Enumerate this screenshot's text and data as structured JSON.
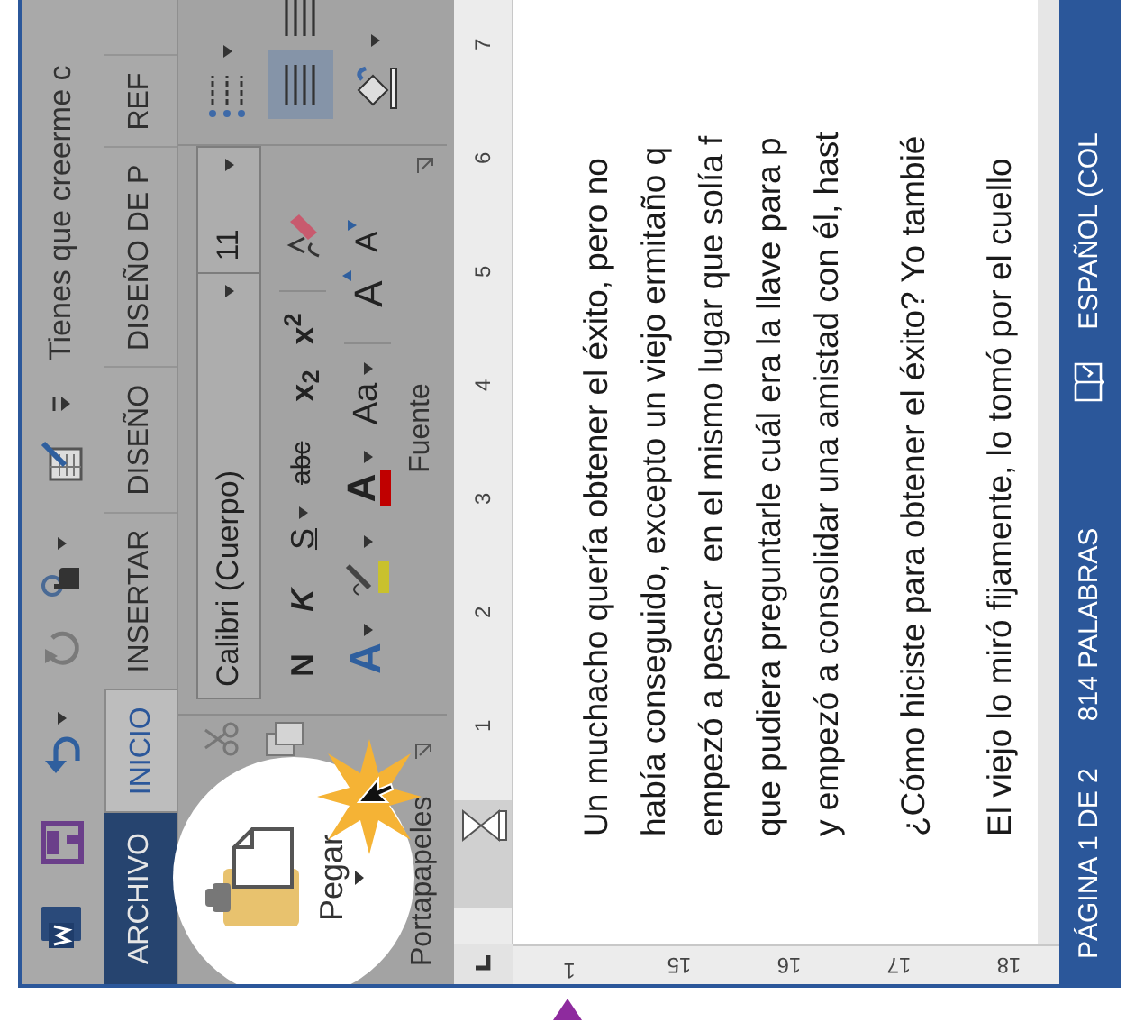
{
  "title_bar": {
    "title": "Tienes que creerme c"
  },
  "tabs": [
    {
      "label": "ARCHIVO",
      "kind": "file",
      "selected": false
    },
    {
      "label": "INICIO",
      "kind": "tab",
      "selected": true
    },
    {
      "label": "INSERTAR",
      "kind": "tab",
      "selected": false
    },
    {
      "label": "DISEÑO",
      "kind": "tab",
      "selected": false
    },
    {
      "label": "DISEÑO DE P",
      "kind": "tab",
      "selected": false
    },
    {
      "label": "REF",
      "kind": "tab",
      "selected": false
    }
  ],
  "ribbon": {
    "clipboard": {
      "paste_label": "Pegar",
      "group_label": "Portapapeles"
    },
    "font": {
      "font_name": "Calibri (Cuerpo)",
      "font_size": "11",
      "bold": "N",
      "italic": "K",
      "underline": "S",
      "strikethrough": "abc",
      "subscript": "x$_{2}$",
      "superscript": "x$^{2}$",
      "text_effects": "A",
      "font_color": "A",
      "change_case": "Aa",
      "grow_font": "A",
      "shrink_font": "A",
      "group_label": "Fuente"
    },
    "paragraph": {
      "align_button_selected": true
    }
  },
  "rulers": {
    "horizontal": [
      "1",
      "2",
      "3",
      "4",
      "5",
      "6",
      "7"
    ],
    "vertical": [
      "1",
      "15",
      "16",
      "17",
      "18"
    ]
  },
  "document": {
    "paragraphs": [
      {
        "lines": [
          "Un muchacho quería obtener el éxito, pero no",
          "había conseguido, excepto un viejo ermitaño q",
          "empezó a pescar  en el mismo lugar que solía f",
          "que pudiera preguntarle cuál era la llave para p",
          "y empezó a consolidar una amistad con él, hast"
        ]
      },
      {
        "lines": [
          "¿Cómo hiciste para obtener el éxito? Yo tambié"
        ]
      },
      {
        "lines": [
          "El viejo lo miró fijamente, lo tomó por el cuello"
        ]
      }
    ]
  },
  "status_bar": {
    "page": "PÁGINA 1 DE 2",
    "words": "814 PALABRAS",
    "language": "ESPAÑOL (COL"
  }
}
